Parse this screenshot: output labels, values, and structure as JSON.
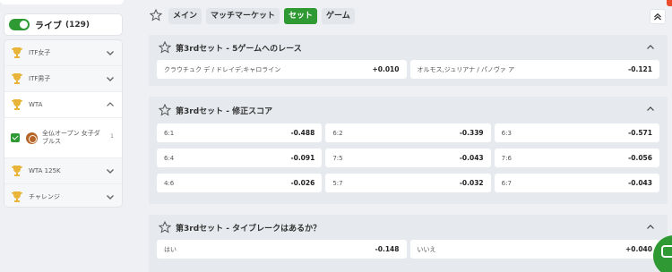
{
  "sidebar": {
    "live": {
      "label": "ライブ",
      "count": "(129)"
    },
    "items": [
      {
        "label": "ITF女子"
      },
      {
        "label": "ITF男子"
      },
      {
        "label": "WTA"
      },
      {
        "label": "WTA 125K"
      },
      {
        "label": "チャレンジ"
      }
    ],
    "sub_item": {
      "label": "全仏オープン 女子ダブルス",
      "count": "1"
    }
  },
  "tabs": [
    "メイン",
    "マッチマーケット",
    "セット",
    "ゲーム"
  ],
  "active_tab": "セット",
  "sections": [
    {
      "title": "第3rdセット - 5ゲームへのレース",
      "rows": [
        [
          {
            "name": "クラウチュク デ / ドレイデ,キャロライン",
            "odd": "+0.010"
          },
          {
            "name": "オルモス,ジュリアナ / パノヴァ ア",
            "odd": "-0.121"
          }
        ]
      ]
    },
    {
      "title": "第3rdセット - 修正スコア",
      "rows": [
        [
          {
            "name": "6:1",
            "odd": "-0.488"
          },
          {
            "name": "6:2",
            "odd": "-0.339"
          },
          {
            "name": "6:3",
            "odd": "-0.571"
          }
        ],
        [
          {
            "name": "6:4",
            "odd": "-0.091"
          },
          {
            "name": "7:5",
            "odd": "-0.043"
          },
          {
            "name": "7:6",
            "odd": "-0.056"
          }
        ],
        [
          {
            "name": "4:6",
            "odd": "-0.026"
          },
          {
            "name": "5:7",
            "odd": "-0.032"
          },
          {
            "name": "6:7",
            "odd": "-0.043"
          }
        ]
      ]
    },
    {
      "title": "第3rdセット - タイブレークはあるか？",
      "rows": [
        [
          {
            "name": "はい",
            "odd": "-0.148"
          },
          {
            "name": "いいえ",
            "odd": "+0.040"
          }
        ]
      ]
    }
  ],
  "colors": {
    "accent": "#2f9a33",
    "trophy": "#e9b43a",
    "background": "#eef0f3"
  }
}
